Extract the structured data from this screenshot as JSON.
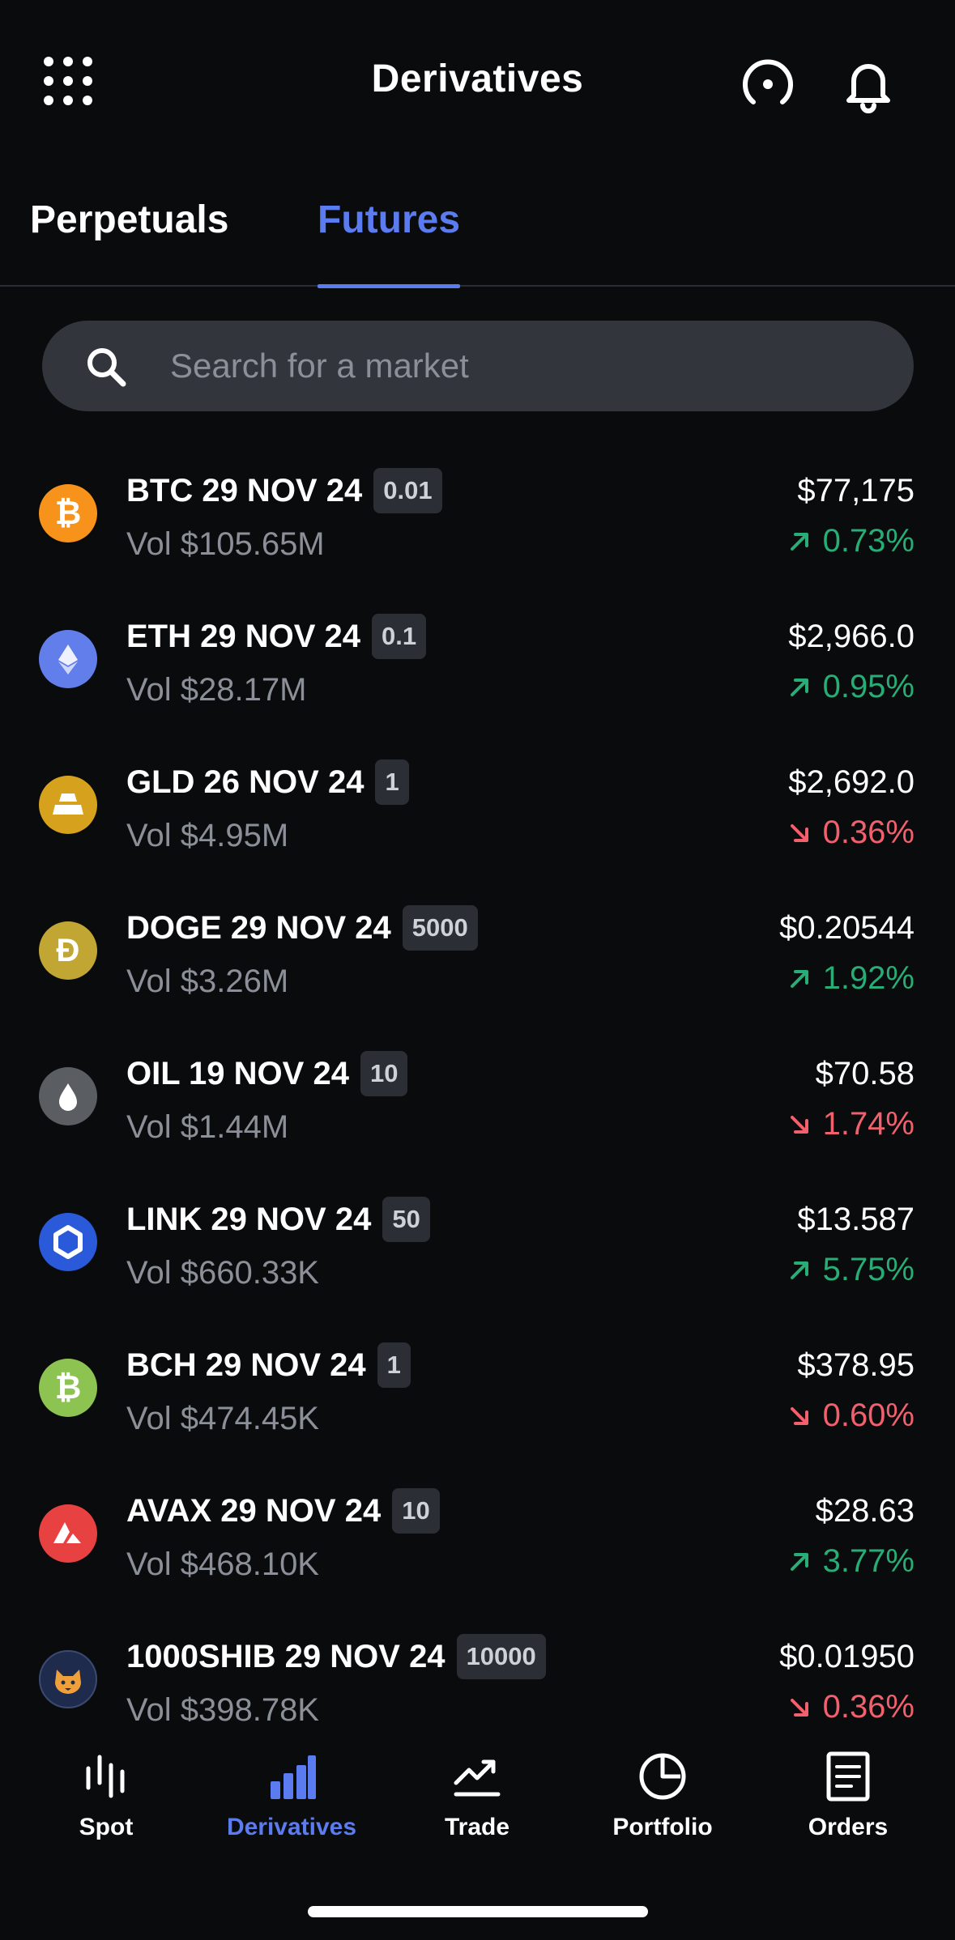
{
  "header": {
    "title": "Derivatives",
    "icons": [
      "grid-menu-icon",
      "gauge-icon",
      "bell-icon"
    ]
  },
  "tabs": [
    {
      "label": "Perpetuals",
      "active": false
    },
    {
      "label": "Futures",
      "active": true
    }
  ],
  "search": {
    "placeholder": "Search for a market"
  },
  "colors": {
    "accent": "#5b7cf0",
    "up": "#27ad75",
    "down": "#f0616d",
    "background": "#0a0b0d"
  },
  "markets": [
    {
      "name": "BTC 29 NOV 24",
      "badge": "0.01",
      "vol": "Vol $105.65M",
      "price": "$77,175",
      "change": "0.73%",
      "direction": "up",
      "icon": "bitcoin-icon",
      "icon_color": "#f7931a",
      "glyph": "₿"
    },
    {
      "name": "ETH 29 NOV 24",
      "badge": "0.1",
      "vol": "Vol $28.17M",
      "price": "$2,966.0",
      "change": "0.95%",
      "direction": "up",
      "icon": "ethereum-icon",
      "icon_color": "#627eea",
      "glyph": "◆"
    },
    {
      "name": "GLD 26 NOV 24",
      "badge": "1",
      "vol": "Vol $4.95M",
      "price": "$2,692.0",
      "change": "0.36%",
      "direction": "down",
      "icon": "gold-icon",
      "icon_color": "#d6a21e",
      "glyph": "▬"
    },
    {
      "name": "DOGE 29 NOV 24",
      "badge": "5000",
      "vol": "Vol $3.26M",
      "price": "$0.20544",
      "change": "1.92%",
      "direction": "up",
      "icon": "dogecoin-icon",
      "icon_color": "#c2a633",
      "glyph": "Ð"
    },
    {
      "name": "OIL 19 NOV 24",
      "badge": "10",
      "vol": "Vol $1.44M",
      "price": "$70.58",
      "change": "1.74%",
      "direction": "down",
      "icon": "oil-drop-icon",
      "icon_color": "#5a5d62",
      "glyph": "●"
    },
    {
      "name": "LINK 29 NOV 24",
      "badge": "50",
      "vol": "Vol $660.33K",
      "price": "$13.587",
      "change": "5.75%",
      "direction": "up",
      "icon": "chainlink-icon",
      "icon_color": "#2a5ada",
      "glyph": "⬡"
    },
    {
      "name": "BCH 29 NOV 24",
      "badge": "1",
      "vol": "Vol $474.45K",
      "price": "$378.95",
      "change": "0.60%",
      "direction": "down",
      "icon": "bitcoin-cash-icon",
      "icon_color": "#8dc351",
      "glyph": "₿"
    },
    {
      "name": "AVAX 29 NOV 24",
      "badge": "10",
      "vol": "Vol $468.10K",
      "price": "$28.63",
      "change": "3.77%",
      "direction": "up",
      "icon": "avalanche-icon",
      "icon_color": "#e84142",
      "glyph": "▲"
    },
    {
      "name": "1000SHIB 29 NOV 24",
      "badge": "10000",
      "vol": "Vol $398.78K",
      "price": "$0.01950",
      "change": "0.36%",
      "direction": "down",
      "icon": "shiba-inu-icon",
      "icon_color": "#1f2b4d",
      "glyph": "🐕"
    }
  ],
  "nav": [
    {
      "label": "Spot",
      "icon": "spot-icon",
      "active": false
    },
    {
      "label": "Derivatives",
      "icon": "derivatives-bars-icon",
      "active": true
    },
    {
      "label": "Trade",
      "icon": "trade-chart-icon",
      "active": false
    },
    {
      "label": "Portfolio",
      "icon": "portfolio-pie-icon",
      "active": false
    },
    {
      "label": "Orders",
      "icon": "orders-document-icon",
      "active": false
    }
  ]
}
